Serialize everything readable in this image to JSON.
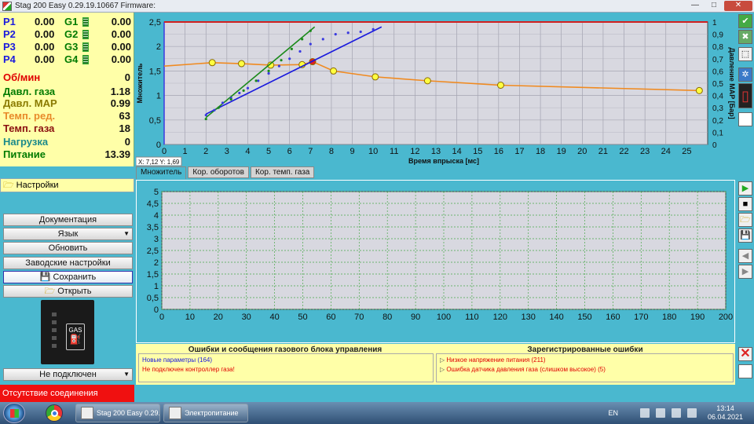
{
  "window": {
    "title": "Stag 200 Easy 0.29.19.10667 Firmware:",
    "minimize": "—",
    "maximize": "□",
    "close": "✕"
  },
  "params": {
    "p_rows": [
      {
        "p": "P1",
        "pv": "0.00",
        "g": "G1",
        "gv": "0.00"
      },
      {
        "p": "P2",
        "pv": "0.00",
        "g": "G2",
        "gv": "0.00"
      },
      {
        "p": "P3",
        "pv": "0.00",
        "g": "G3",
        "gv": "0.00"
      },
      {
        "p": "P4",
        "pv": "0.00",
        "g": "G4",
        "gv": "0.00"
      }
    ],
    "readings": [
      {
        "label": "Об/мин",
        "value": "0",
        "color": "#e00000"
      },
      {
        "label": "Давл. газа",
        "value": "1.18",
        "color": "#007a00"
      },
      {
        "label": "Давл. MAP",
        "value": "0.99",
        "color": "#8a7a00"
      },
      {
        "label": "Темп. ред.",
        "value": "63",
        "color": "#e88a2a"
      },
      {
        "label": "Темп. газа",
        "value": "18",
        "color": "#8a1010"
      },
      {
        "label": "Нагрузка",
        "value": "0",
        "color": "#1a8a8a"
      },
      {
        "label": "Питание",
        "value": "13.39",
        "color": "#007a00"
      }
    ]
  },
  "settings": {
    "header": "Настройки",
    "buttons": {
      "docs": "Документация",
      "language": "Язык",
      "update": "Обновить",
      "factory": "Заводские настройки",
      "save": "Сохранить",
      "open": "Открыть"
    },
    "connection_select": "Не подключен",
    "status": "Отсутствие соединения",
    "device_label": "GAS"
  },
  "tabs": [
    "Множитель",
    "Кор. оборотов",
    "Кор. темп. газа"
  ],
  "cursor_readout": "X: 7,12  Y: 1,69",
  "chart_data": [
    {
      "type": "line",
      "xlabel": "Время впрыска [мс]",
      "ylabel": "Множитель",
      "y2label": "Давление MAP [Бар]",
      "xlim": [
        0,
        26
      ],
      "ylim": [
        0,
        2.5
      ],
      "y2lim": [
        0,
        1
      ],
      "xticks": [
        0,
        1,
        2,
        3,
        4,
        5,
        6,
        7,
        8,
        9,
        10,
        11,
        12,
        13,
        14,
        15,
        16,
        17,
        18,
        19,
        20,
        21,
        22,
        23,
        24,
        25
      ],
      "yticks": [
        "0",
        "0,5",
        "1",
        "1,5",
        "2",
        "2,5"
      ],
      "y2ticks": [
        "0",
        "0,1",
        "0,2",
        "0,3",
        "0,4",
        "0,5",
        "0,6",
        "0,7",
        "0,8",
        "0,9",
        "1"
      ],
      "grid": true,
      "series": [
        {
          "color": "#f08a20",
          "points": [
            [
              0,
              1.6
            ],
            [
              2.3,
              1.67
            ],
            [
              3.7,
              1.65
            ],
            [
              5.1,
              1.62
            ],
            [
              6.6,
              1.63
            ],
            [
              7.1,
              1.69
            ],
            [
              8.1,
              1.5
            ],
            [
              10.1,
              1.38
            ],
            [
              12.6,
              1.3
            ],
            [
              16.1,
              1.21
            ],
            [
              25.6,
              1.1
            ]
          ]
        },
        {
          "color": "#1a1add",
          "points": [
            [
              2,
              0.62
            ],
            [
              10.4,
              2.4
            ]
          ]
        },
        {
          "color": "#1a8a1a",
          "points": [
            [
              2,
              0.55
            ],
            [
              7.2,
              2.4
            ]
          ]
        },
        {
          "color": "#d02020",
          "points": [
            [
              0,
              2.5
            ],
            [
              26,
              2.5
            ]
          ]
        }
      ]
    },
    {
      "type": "line",
      "xlim": [
        0,
        200
      ],
      "ylim": [
        0,
        5
      ],
      "xticks": [
        0,
        10,
        20,
        30,
        40,
        50,
        60,
        70,
        80,
        90,
        100,
        110,
        120,
        130,
        140,
        150,
        160,
        170,
        180,
        190,
        200
      ],
      "yticks": [
        "0",
        "0,5",
        "1",
        "1,5",
        "2",
        "2,5",
        "3",
        "3,5",
        "4",
        "4,5",
        "5"
      ],
      "grid": true,
      "series": []
    }
  ],
  "errors": {
    "left_title": "Ошибки и сообщения газового блока управления",
    "left_items": [
      {
        "text": "Новые параметры (164)",
        "color": "#1a1add"
      },
      {
        "text": "Не подключен контроллер газа!",
        "color": "#e00000"
      }
    ],
    "right_title": "Зарегистрированные ошибки",
    "right_items": [
      {
        "text": "Низкое напряжение питания (211)",
        "color": "#e00000"
      },
      {
        "text": "Ошибка датчика давления газа (слишком высокое) (5)",
        "color": "#e00000"
      }
    ]
  },
  "taskbar": {
    "apps": [
      "Stag 200 Easy 0.29....",
      "Электропитание"
    ],
    "lang": "EN",
    "time": "13:14",
    "date": "06.04.2021"
  }
}
